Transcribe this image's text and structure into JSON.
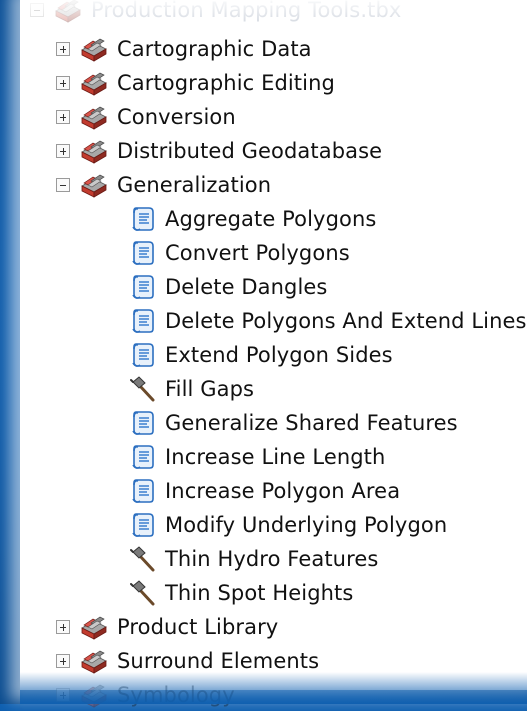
{
  "root": {
    "label": "Production Mapping Tools.tbx",
    "icon": "toolbox-icon"
  },
  "toolsets_before": [
    {
      "label": "Cartographic Data",
      "icon": "toolbox-icon",
      "expanded": false
    },
    {
      "label": "Cartographic Editing",
      "icon": "toolbox-icon",
      "expanded": false
    },
    {
      "label": "Conversion",
      "icon": "toolbox-icon",
      "expanded": false
    },
    {
      "label": "Distributed Geodatabase",
      "icon": "toolbox-icon",
      "expanded": false
    }
  ],
  "expanded_toolset": {
    "label": "Generalization",
    "icon": "toolbox-icon",
    "expanded": true,
    "tools": [
      {
        "label": "Aggregate Polygons",
        "icon": "script-icon"
      },
      {
        "label": "Convert Polygons",
        "icon": "script-icon"
      },
      {
        "label": "Delete Dangles",
        "icon": "script-icon"
      },
      {
        "label": "Delete Polygons And Extend Lines",
        "icon": "script-icon"
      },
      {
        "label": "Extend Polygon Sides",
        "icon": "script-icon"
      },
      {
        "label": "Fill Gaps",
        "icon": "hammer-icon"
      },
      {
        "label": "Generalize Shared Features",
        "icon": "script-icon"
      },
      {
        "label": "Increase Line Length",
        "icon": "script-icon"
      },
      {
        "label": "Increase Polygon Area",
        "icon": "script-icon"
      },
      {
        "label": "Modify Underlying Polygon",
        "icon": "script-icon"
      },
      {
        "label": "Thin Hydro Features",
        "icon": "hammer-icon"
      },
      {
        "label": "Thin Spot Heights",
        "icon": "hammer-icon"
      }
    ]
  },
  "toolsets_after": [
    {
      "label": "Product Library",
      "icon": "toolbox-icon",
      "expanded": false
    },
    {
      "label": "Surround Elements",
      "icon": "toolbox-icon",
      "expanded": false
    },
    {
      "label": "Symbology",
      "icon": "toolbox-icon",
      "expanded": false
    }
  ]
}
